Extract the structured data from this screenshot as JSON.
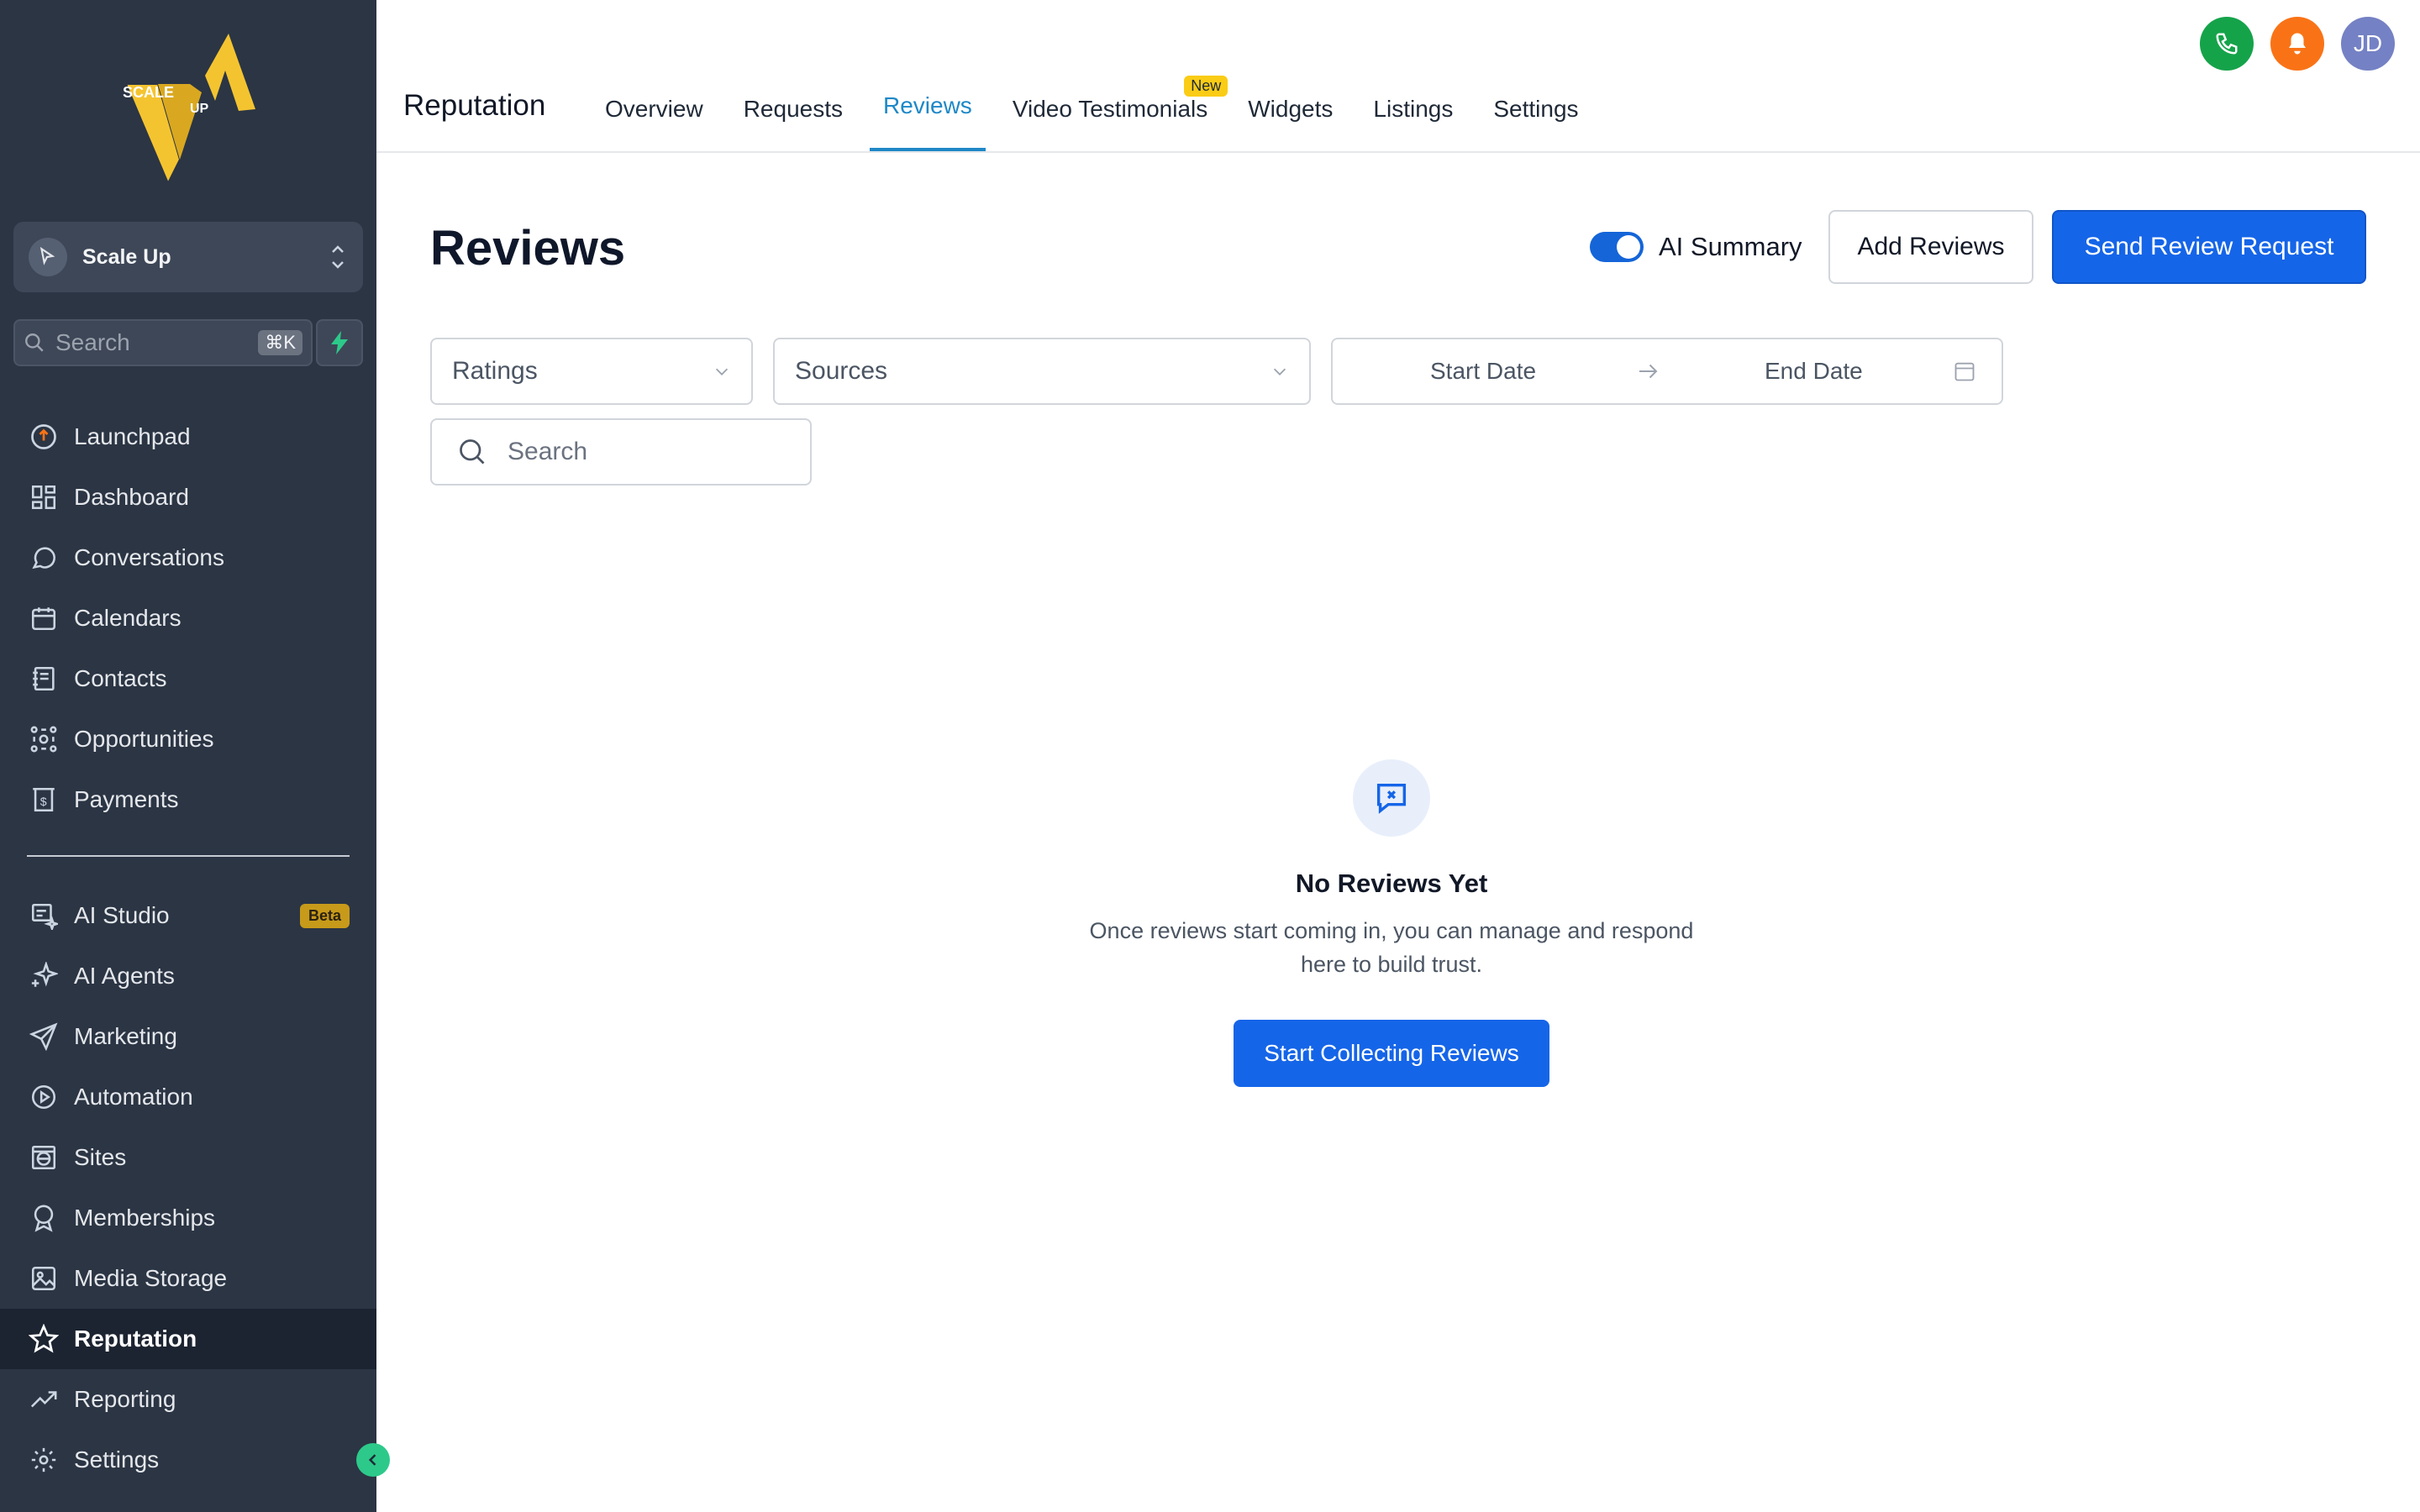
{
  "sidebar": {
    "logo": {
      "line1": "SCALE",
      "line2": "UP"
    },
    "account": {
      "name": "Scale Up"
    },
    "search": {
      "placeholder": "Search",
      "shortcut": "⌘K"
    },
    "items_primary": [
      {
        "label": "Launchpad",
        "icon": "rocket-icon"
      },
      {
        "label": "Dashboard",
        "icon": "grid-icon"
      },
      {
        "label": "Conversations",
        "icon": "chat-icon"
      },
      {
        "label": "Calendars",
        "icon": "calendar-icon"
      },
      {
        "label": "Contacts",
        "icon": "contacts-icon"
      },
      {
        "label": "Opportunities",
        "icon": "opportunities-icon"
      },
      {
        "label": "Payments",
        "icon": "payments-icon"
      }
    ],
    "items_secondary": [
      {
        "label": "AI Studio",
        "icon": "ai-studio-icon",
        "badge": "Beta"
      },
      {
        "label": "AI Agents",
        "icon": "sparkles-icon"
      },
      {
        "label": "Marketing",
        "icon": "send-icon"
      },
      {
        "label": "Automation",
        "icon": "automation-icon"
      },
      {
        "label": "Sites",
        "icon": "globe-icon"
      },
      {
        "label": "Memberships",
        "icon": "award-icon"
      },
      {
        "label": "Media Storage",
        "icon": "image-icon"
      },
      {
        "label": "Reputation",
        "icon": "star-icon",
        "active": true
      },
      {
        "label": "Reporting",
        "icon": "trend-icon"
      },
      {
        "label": "Settings",
        "icon": "gear-icon"
      }
    ]
  },
  "topbar": {
    "module_title": "Reputation",
    "tabs": [
      {
        "label": "Overview"
      },
      {
        "label": "Requests"
      },
      {
        "label": "Reviews",
        "active": true
      },
      {
        "label": "Video Testimonials",
        "badge": "New"
      },
      {
        "label": "Widgets"
      },
      {
        "label": "Listings"
      },
      {
        "label": "Settings"
      }
    ],
    "avatar_initials": "JD"
  },
  "main": {
    "title": "Reviews",
    "ai_summary_label": "AI Summary",
    "ai_summary_on": true,
    "add_reviews_label": "Add Reviews",
    "send_request_label": "Send Review Request",
    "filters": {
      "ratings_placeholder": "Ratings",
      "sources_placeholder": "Sources",
      "start_date": "Start Date",
      "end_date": "End Date",
      "search_placeholder": "Search"
    },
    "empty": {
      "title": "No Reviews Yet",
      "line1": "Once reviews start coming in, you can manage and respond",
      "line2": "here to build trust.",
      "cta": "Start Collecting Reviews"
    }
  },
  "colors": {
    "sidebar_bg": "#2b3544",
    "primary": "#1565e8",
    "active_tab": "#1e88c7",
    "phone": "#15a34a",
    "bell": "#f97316",
    "avatar": "#7481c4"
  }
}
